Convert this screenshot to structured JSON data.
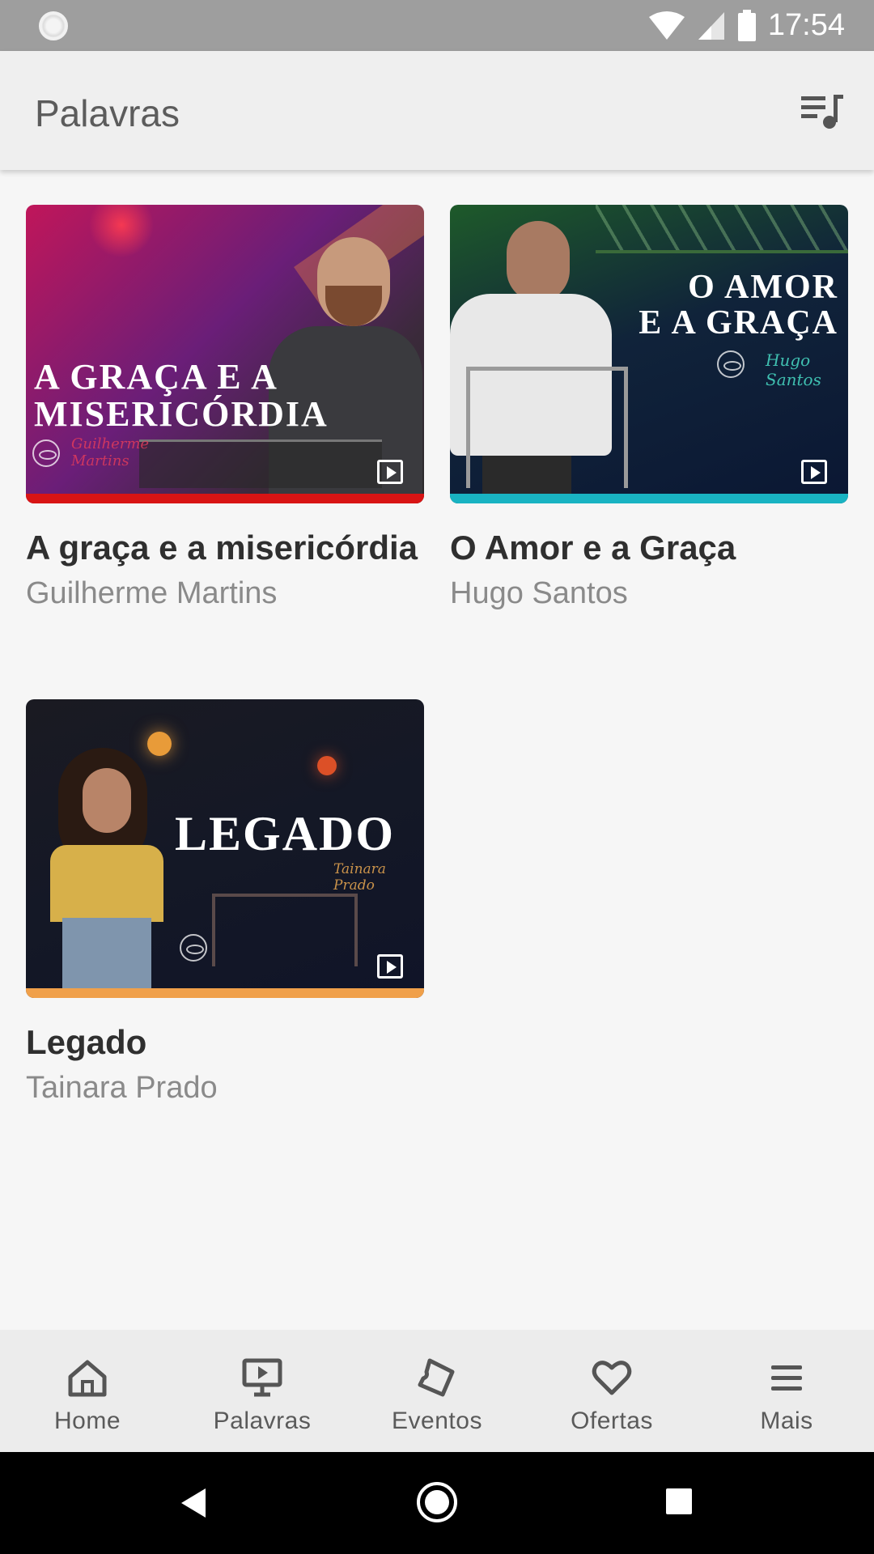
{
  "status_bar": {
    "time": "17:54"
  },
  "app_bar": {
    "title": "Palavras"
  },
  "videos": [
    {
      "title": "A graça e a misericórdia",
      "speaker": "Guilherme Martins",
      "thumb_text_line1": "A GRAÇA E A",
      "thumb_text_line2": "MISERICÓRDIA",
      "thumb_signature": "Guilherme Martins",
      "accent_color": "#d81414"
    },
    {
      "title": "O Amor e a Graça",
      "speaker": "Hugo Santos",
      "thumb_text_line1": "O AMOR",
      "thumb_text_line2": "E A GRAÇA",
      "thumb_signature": "Hugo Santos",
      "accent_color": "#19b3c2"
    },
    {
      "title": "Legado",
      "speaker": "Tainara Prado",
      "thumb_text_line1": "LEGADO",
      "thumb_signature": "Tainara Prado",
      "accent_color": "#f0a04a"
    }
  ],
  "bottom_nav": {
    "items": [
      {
        "label": "Home",
        "icon": "home-icon"
      },
      {
        "label": "Palavras",
        "icon": "presentation-icon"
      },
      {
        "label": "Eventos",
        "icon": "ticket-icon"
      },
      {
        "label": "Ofertas",
        "icon": "heart-icon"
      },
      {
        "label": "Mais",
        "icon": "menu-icon"
      }
    ]
  }
}
